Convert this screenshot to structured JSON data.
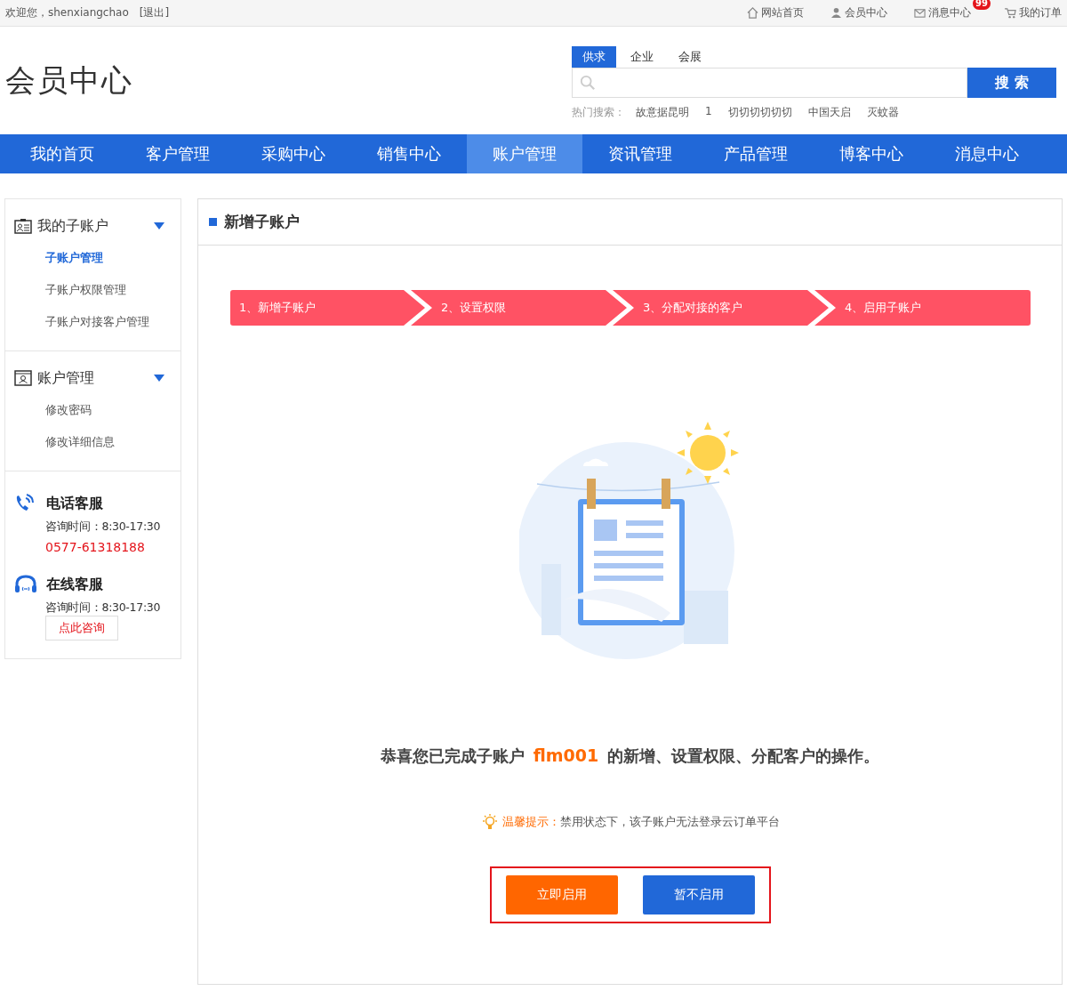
{
  "top_bar": {
    "greeting": "欢迎您，shenxiangchao",
    "logout": "[退出]",
    "links": [
      {
        "kind": "home",
        "label": "网站首页"
      },
      {
        "kind": "member",
        "label": "会员中心"
      },
      {
        "kind": "message",
        "label": "消息中心",
        "badge": "99"
      },
      {
        "kind": "cart",
        "label": "我的订单"
      }
    ]
  },
  "header": {
    "logo": "会员中心",
    "search_tabs": [
      {
        "label": "供求",
        "selected": true
      },
      {
        "label": "企业",
        "selected": false
      },
      {
        "label": "会展",
        "selected": false
      }
    ],
    "search_button": "搜 索",
    "hot_label": "热门搜索：",
    "hot_terms": [
      "故意据昆明",
      "1",
      "切切切切切切",
      "中国天启",
      "灭蚊器"
    ]
  },
  "nav": [
    {
      "label": "我的首页",
      "selected": false
    },
    {
      "label": "客户管理",
      "selected": false
    },
    {
      "label": "采购中心",
      "selected": false
    },
    {
      "label": "销售中心",
      "selected": false
    },
    {
      "label": "账户管理",
      "selected": true
    },
    {
      "label": "资讯管理",
      "selected": false
    },
    {
      "label": "产品管理",
      "selected": false
    },
    {
      "label": "博客中心",
      "selected": false
    },
    {
      "label": "消息中心",
      "selected": false
    }
  ],
  "sidebar": {
    "groups": [
      {
        "kind": "subaccount",
        "title": "我的子账户",
        "expanded": true,
        "items": [
          {
            "label": "子账户管理",
            "selected": true
          },
          {
            "label": "子账户权限管理",
            "selected": false
          },
          {
            "label": "子账户对接客户管理",
            "selected": false
          }
        ]
      },
      {
        "kind": "account",
        "title": "账户管理",
        "expanded": true,
        "items": [
          {
            "label": "修改密码",
            "selected": false
          },
          {
            "label": "修改详细信息",
            "selected": false
          }
        ]
      }
    ],
    "service": [
      {
        "kind": "phone",
        "title": "电话客服",
        "hours": "咨询时间：8:30-17:30",
        "phone": "0577-61318188"
      },
      {
        "kind": "online",
        "title": "在线客服",
        "hours": "咨询时间：8:30-17:30",
        "button": "点此咨询"
      }
    ]
  },
  "main": {
    "title": "新增子账户",
    "steps": [
      "1、新增子账户",
      "2、设置权限",
      "3、分配对接的客户",
      "4、启用子账户"
    ],
    "message_before": "恭喜您已完成子账户",
    "account": "flm001",
    "message_after": "的新增、设置权限、分配客户的操作。",
    "tip_label": "温馨提示：",
    "tip_text": "禁用状态下，该子账户无法登录云订单平台",
    "buttons": [
      {
        "kind": "enable",
        "label": "立即启用"
      },
      {
        "kind": "later",
        "label": "暂不启用"
      }
    ]
  }
}
